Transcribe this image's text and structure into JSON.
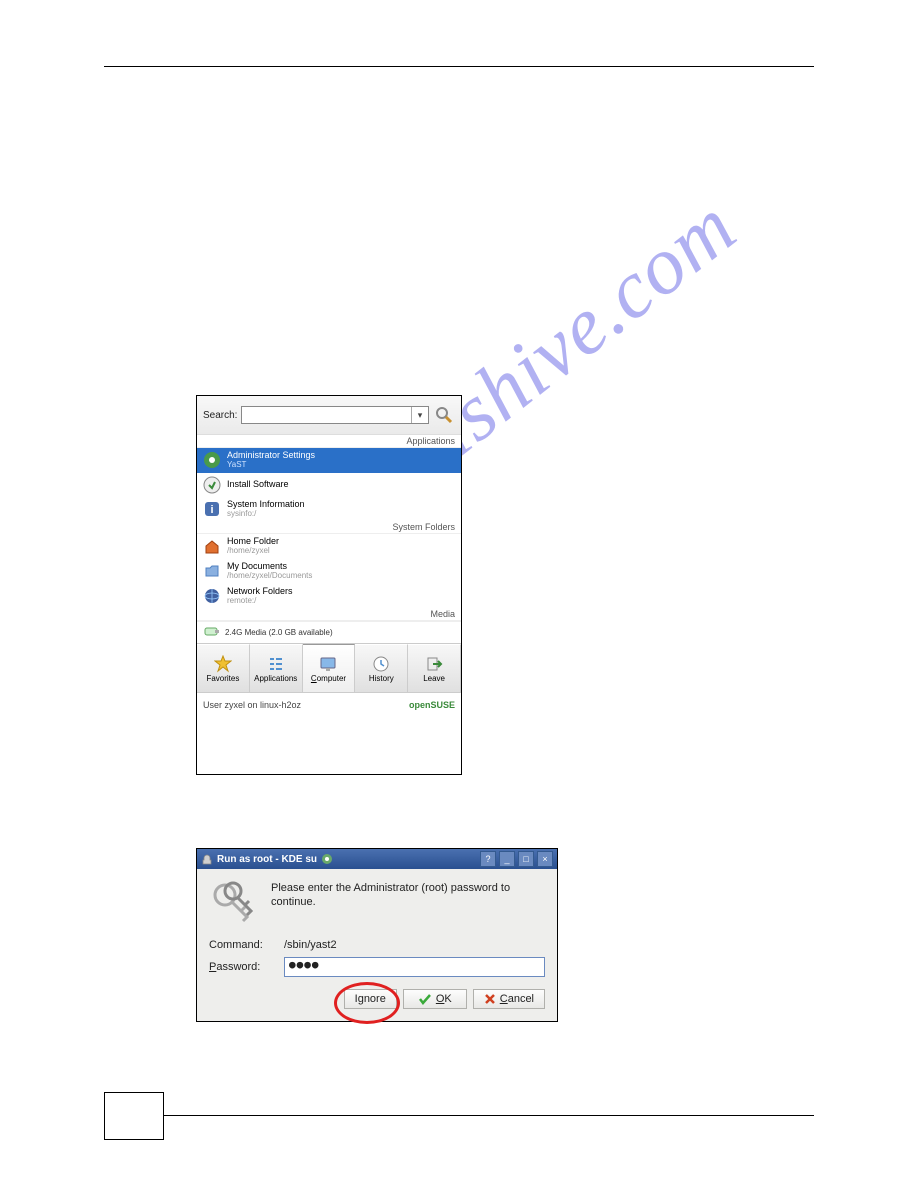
{
  "watermark": "manualshive.com",
  "kde": {
    "search_label": "Search:",
    "cat_applications": "Applications",
    "cat_folders": "System Folders",
    "cat_media": "Media",
    "items": {
      "admin": {
        "title": "Administrator Settings",
        "sub": "YaST"
      },
      "install": {
        "title": "Install Software",
        "sub": ""
      },
      "sysinfo": {
        "title": "System Information",
        "sub": "sysinfo:/"
      },
      "home": {
        "title": "Home Folder",
        "sub": "/home/zyxel"
      },
      "docs": {
        "title": "My Documents",
        "sub": "/home/zyxel/Documents"
      },
      "network": {
        "title": "Network Folders",
        "sub": "remote:/"
      }
    },
    "media_item": "2.4G Media (2.0 GB available)",
    "tabs": {
      "favorites": "Favorites",
      "applications": "Applications",
      "computer": "Computer",
      "history": "History",
      "leave": "Leave"
    },
    "footer_user": "User zyxel on linux-h2oz",
    "footer_brand": "openSUSE"
  },
  "dlg": {
    "title": "Run as root - KDE su",
    "msg": "Please enter the Administrator (root) password to continue.",
    "cmd_label": "Command:",
    "cmd_value": "/sbin/yast2",
    "pwd_label": "Password:",
    "pwd_value": "●●●●",
    "btn_ignore": "Ignore",
    "btn_ok": "OK",
    "btn_cancel": "Cancel"
  }
}
